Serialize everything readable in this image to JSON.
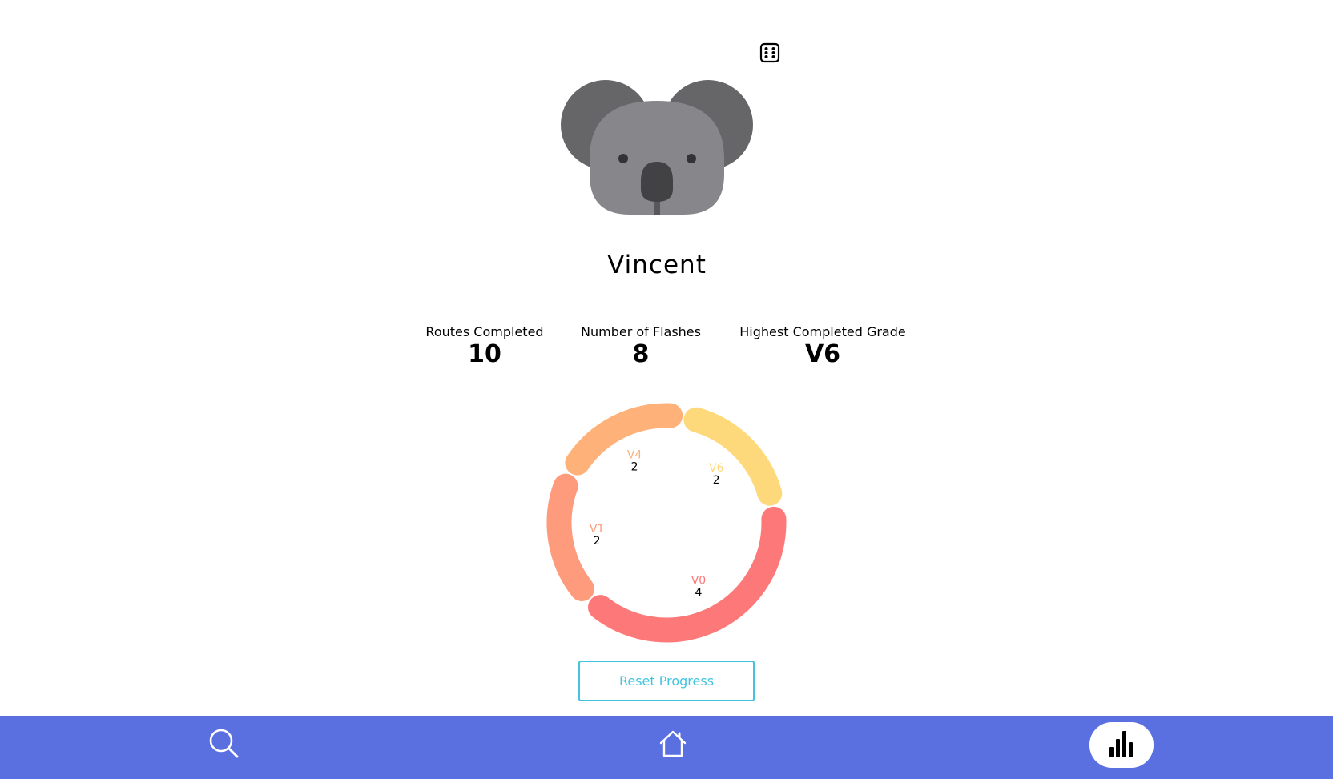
{
  "profile": {
    "name": "Vincent",
    "avatar_icon": "koala-avatar",
    "randomize_icon": "dice-icon"
  },
  "stats": {
    "routes_completed_label": "Routes Completed",
    "routes_completed_value": "10",
    "flashes_label": "Number of Flashes",
    "flashes_value": "8",
    "highest_grade_label": "Highest Completed Grade",
    "highest_grade_value": "V6"
  },
  "chart_data": {
    "type": "pie",
    "style": "donut",
    "categories": [
      "V0",
      "V1",
      "V4",
      "V6"
    ],
    "values": [
      4,
      2,
      2,
      2
    ],
    "colors": [
      "#fd7979",
      "#fe9b7c",
      "#feb27a",
      "#fed97b"
    ],
    "value_labels": [
      "4",
      "2",
      "2",
      "2"
    ]
  },
  "actions": {
    "reset_label": "Reset Progress"
  },
  "nav": {
    "items": [
      {
        "icon": "search-icon",
        "active": false
      },
      {
        "icon": "home-icon",
        "active": false
      },
      {
        "icon": "bar-chart-icon",
        "active": true
      }
    ]
  },
  "colors": {
    "nav_background": "#5a6fe0",
    "accent": "#43c4de"
  }
}
